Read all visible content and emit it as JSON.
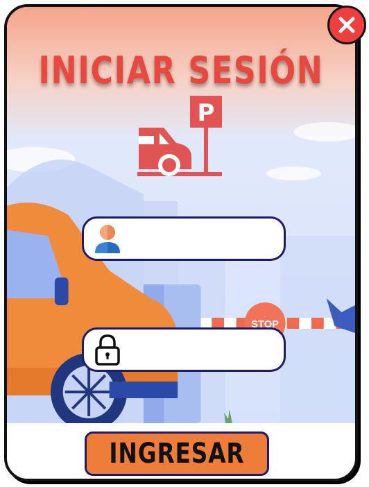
{
  "title": "INICIAR SESIÓN",
  "close_button": {
    "icon": "close-icon",
    "color": "#ee3e3e"
  },
  "logo": {
    "icon": "parking-car-icon",
    "sign_letter": "P",
    "color": "#e05454"
  },
  "username_field": {
    "icon": "user-icon",
    "value": "",
    "placeholder": ""
  },
  "password_field": {
    "icon": "lock-icon",
    "value": "",
    "placeholder": ""
  },
  "submit_button": {
    "label": "INGRESAR",
    "color": "#ef7d3a"
  },
  "background": {
    "stop_sign_text": "STOP"
  },
  "colors": {
    "title": "#e8483d",
    "field_border": "#1e1b6b",
    "sky_top": "#f6b7a0",
    "sky": "#dbe6fb"
  }
}
